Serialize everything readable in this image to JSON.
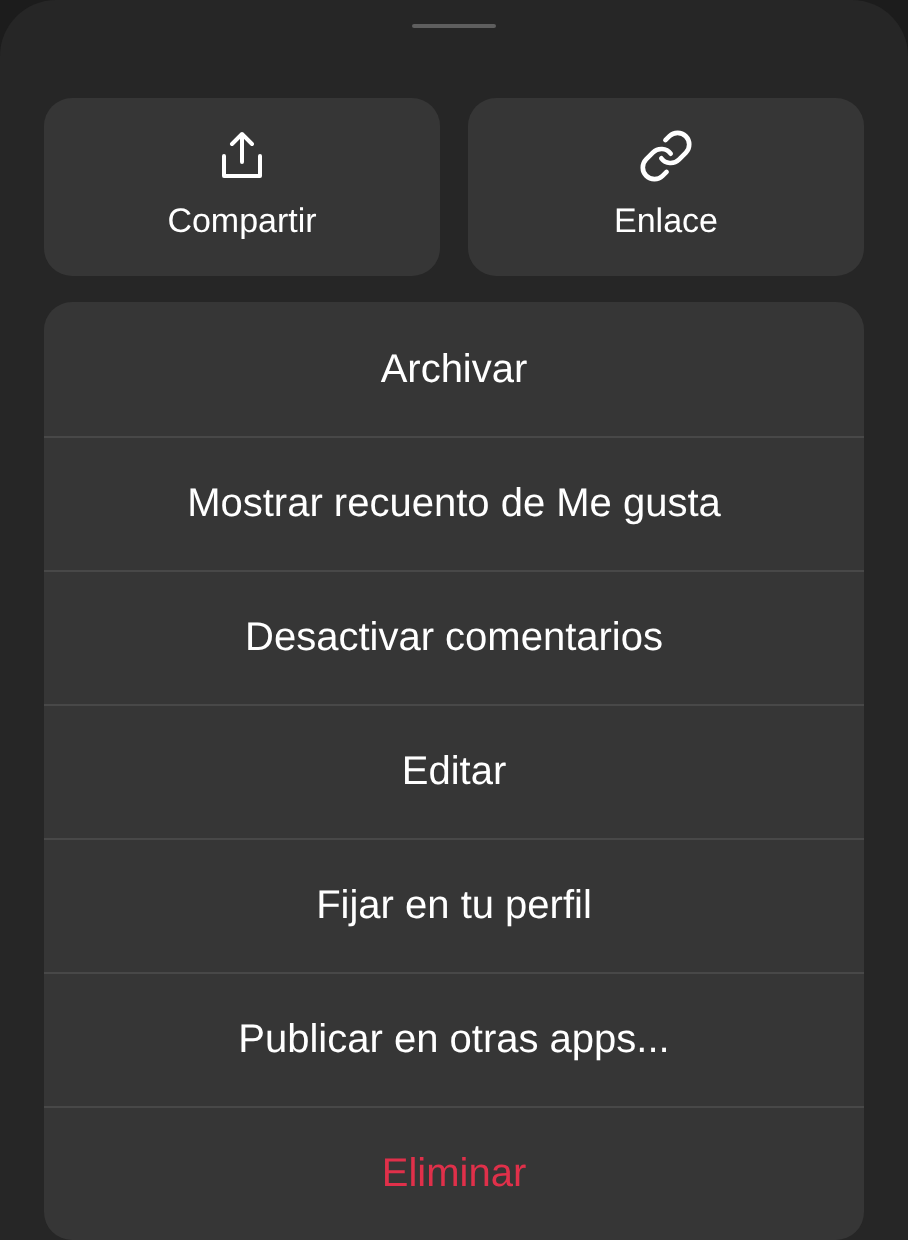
{
  "actions": [
    {
      "kind": "share",
      "label": "Compartir"
    },
    {
      "kind": "link",
      "label": "Enlace"
    }
  ],
  "menu": [
    {
      "label": "Archivar",
      "kind": "normal"
    },
    {
      "label": "Mostrar recuento de Me gusta",
      "kind": "normal"
    },
    {
      "label": "Desactivar comentarios",
      "kind": "normal"
    },
    {
      "label": "Editar",
      "kind": "normal"
    },
    {
      "label": "Fijar en tu perfil",
      "kind": "normal"
    },
    {
      "label": "Publicar en otras apps...",
      "kind": "normal"
    },
    {
      "label": "Eliminar",
      "kind": "destructive"
    }
  ]
}
